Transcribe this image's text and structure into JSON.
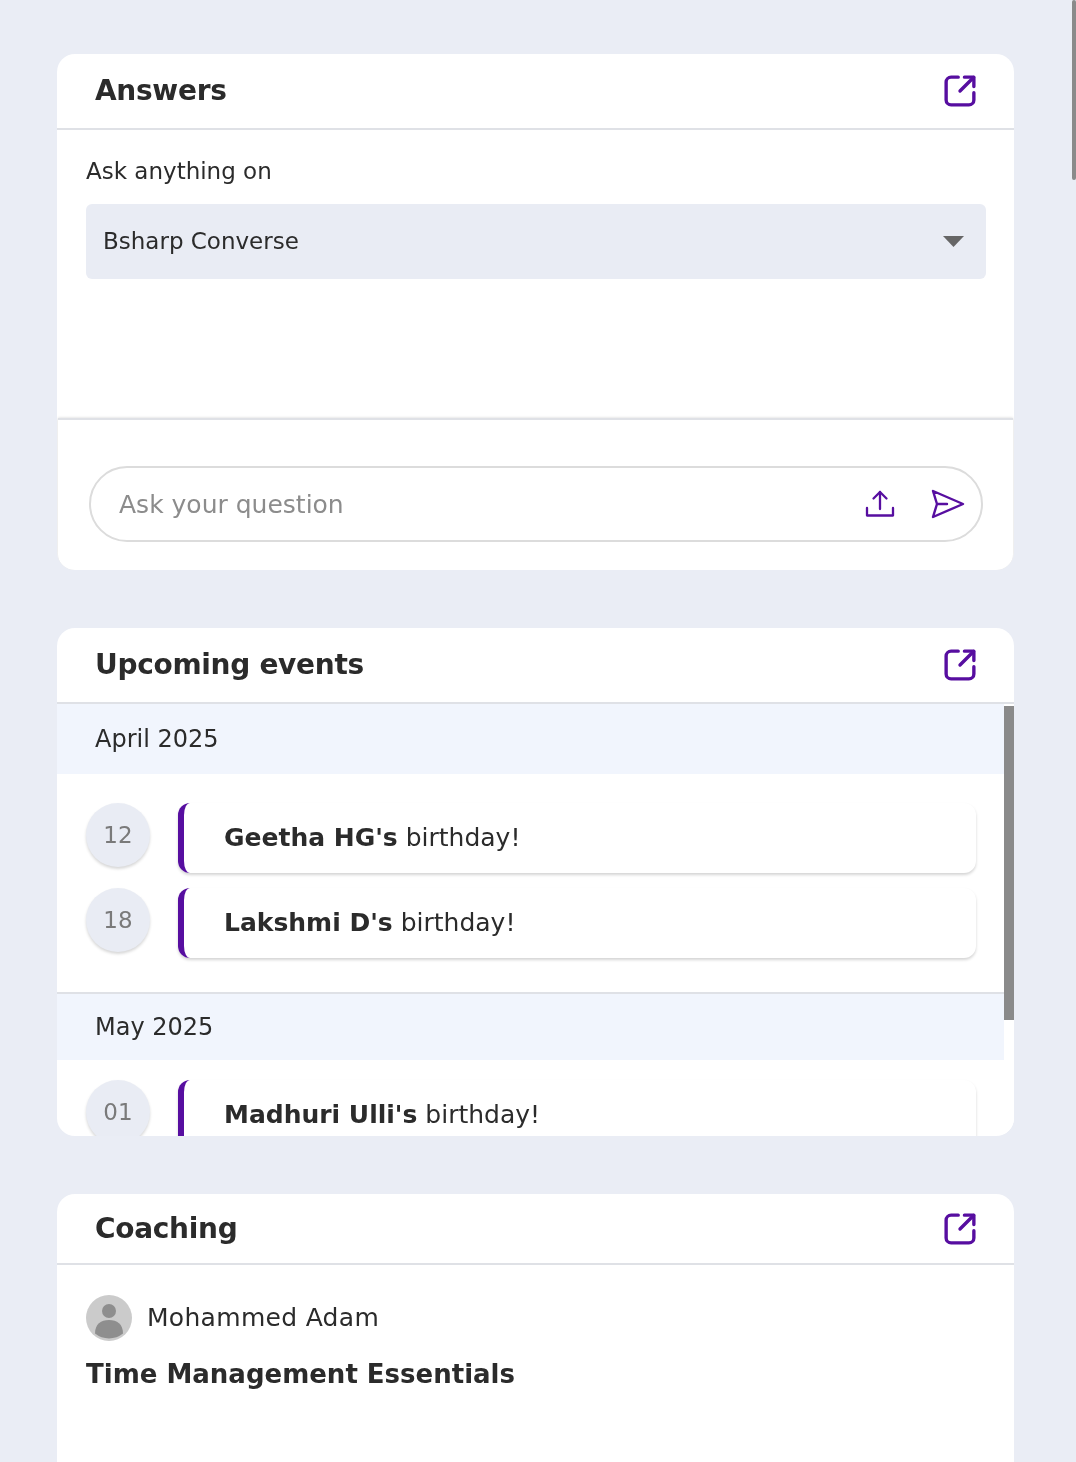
{
  "answers": {
    "title": "Answers",
    "prompt_label": "Ask anything on",
    "source_select": {
      "value": "Bsharp Converse"
    },
    "question_field": {
      "placeholder": "Ask your question"
    }
  },
  "upcoming_events": {
    "title": "Upcoming events",
    "months": [
      {
        "label": "April 2025",
        "events": [
          {
            "day": "12",
            "text": "**Geetha HG's** birthday!"
          },
          {
            "day": "18",
            "text": "**Lakshmi D's** birthday!"
          }
        ]
      },
      {
        "label": "May 2025",
        "events": [
          {
            "day": "01",
            "text": "**Madhuri Ulli's** birthday!"
          }
        ]
      }
    ]
  },
  "coaching": {
    "title": "Coaching",
    "coach_name": "Mohammed Adam",
    "session_title": "Time Management Essentials"
  }
}
